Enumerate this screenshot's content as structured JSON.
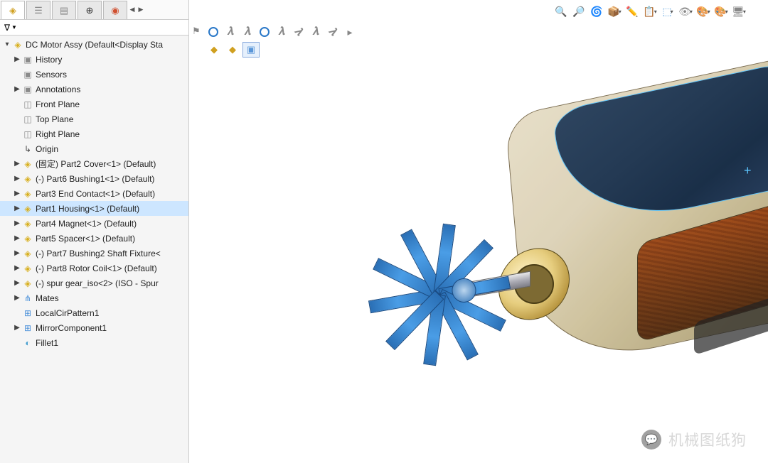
{
  "tabs": [
    "assembly",
    "config",
    "property",
    "origin",
    "appearance"
  ],
  "filter_label": "▼",
  "tree": {
    "root": {
      "icon": "asm",
      "label": "DC Motor Assy  (Default<Display Sta",
      "exp": true
    },
    "nodes": [
      {
        "indent": 1,
        "toggle": "▶",
        "icon": "grey",
        "label": "History"
      },
      {
        "indent": 1,
        "toggle": "",
        "icon": "grey",
        "label": "Sensors"
      },
      {
        "indent": 1,
        "toggle": "▶",
        "icon": "grey",
        "label": "Annotations"
      },
      {
        "indent": 1,
        "toggle": "",
        "icon": "plane",
        "label": "Front Plane"
      },
      {
        "indent": 1,
        "toggle": "",
        "icon": "plane",
        "label": "Top Plane"
      },
      {
        "indent": 1,
        "toggle": "",
        "icon": "plane",
        "label": "Right Plane"
      },
      {
        "indent": 1,
        "toggle": "",
        "icon": "origin",
        "label": "Origin"
      },
      {
        "indent": 1,
        "toggle": "▶",
        "icon": "part",
        "label": "(固定) Part2 Cover<1> (Default)"
      },
      {
        "indent": 1,
        "toggle": "▶",
        "icon": "part",
        "label": "(-) Part6 Bushing1<1> (Default)"
      },
      {
        "indent": 1,
        "toggle": "▶",
        "icon": "part",
        "label": "Part3 End Contact<1> (Default)"
      },
      {
        "indent": 1,
        "toggle": "▶",
        "icon": "part",
        "label": "Part1 Housing<1> (Default)",
        "selected": true
      },
      {
        "indent": 1,
        "toggle": "▶",
        "icon": "part",
        "label": "Part4 Magnet<1> (Default)"
      },
      {
        "indent": 1,
        "toggle": "▶",
        "icon": "part",
        "label": "Part5 Spacer<1> (Default)"
      },
      {
        "indent": 1,
        "toggle": "▶",
        "icon": "part",
        "label": "(-) Part7 Bushing2 Shaft Fixture<"
      },
      {
        "indent": 1,
        "toggle": "▶",
        "icon": "part",
        "label": "(-) Part8 Rotor Coil<1> (Default)"
      },
      {
        "indent": 1,
        "toggle": "▶",
        "icon": "part",
        "label": "(-) spur gear_iso<2> (ISO - Spur"
      },
      {
        "indent": 1,
        "toggle": "▶",
        "icon": "mate",
        "label": "Mates"
      },
      {
        "indent": 1,
        "toggle": "",
        "icon": "feat",
        "label": "LocalCirPattern1"
      },
      {
        "indent": 1,
        "toggle": "▶",
        "icon": "feat",
        "label": "MirrorComponent1"
      },
      {
        "indent": 1,
        "toggle": "",
        "icon": "fillet",
        "label": "Fillet1"
      }
    ]
  },
  "main_toolbar": [
    {
      "name": "zoom-fit-icon",
      "glyph": "🔍",
      "color": "#3a78c8"
    },
    {
      "name": "zoom-area-icon",
      "glyph": "🔎",
      "color": "#3a78c8"
    },
    {
      "name": "zoom-previous-icon",
      "glyph": "🌀",
      "color": "#e08030"
    },
    {
      "name": "section-view-icon",
      "glyph": "📦",
      "color": "#3a78c8",
      "dd": true
    },
    {
      "name": "dynamic-view-icon",
      "glyph": "✏️",
      "color": "#e08030"
    },
    {
      "name": "view-orientation-icon",
      "glyph": "📋",
      "color": "#3a78c8",
      "dd": true
    },
    {
      "name": "display-style-icon",
      "glyph": "⬚",
      "color": "#5aa0dd",
      "dd": true
    },
    {
      "name": "hide-show-icon",
      "glyph": "👁",
      "color": "#888",
      "dd": true
    },
    {
      "name": "edit-appearance-icon",
      "glyph": "🎨",
      "color": "#d0503a",
      "dd": true
    },
    {
      "name": "scene-icon",
      "glyph": "🎨",
      "color": "#d0503a",
      "dd": true
    },
    {
      "name": "display-icon",
      "glyph": "🖥",
      "color": "#888",
      "dd": true
    }
  ],
  "sub_toolbar": [
    {
      "name": "concentric-1",
      "type": "circ"
    },
    {
      "name": "axis-1",
      "type": "lam"
    },
    {
      "name": "axis-2",
      "type": "lam"
    },
    {
      "name": "concentric-2",
      "type": "circ"
    },
    {
      "name": "axis-3",
      "type": "lam"
    },
    {
      "name": "edge-1",
      "type": "lam",
      "rot": 45
    },
    {
      "name": "axis-4",
      "type": "lam"
    },
    {
      "name": "edge-2",
      "type": "lam",
      "rot": 45
    },
    {
      "name": "more",
      "type": "arrow"
    }
  ],
  "cfg_bar": [
    {
      "name": "cfg-assembly",
      "glyph": "◆",
      "color": "#d0a020"
    },
    {
      "name": "cfg-part",
      "glyph": "◆",
      "color": "#d0a020"
    },
    {
      "name": "cfg-solid",
      "glyph": "▣",
      "color": "#5a96d8",
      "active": true
    }
  ],
  "flag": "⚑",
  "watermark": {
    "icon": "💬",
    "text": "机械图纸狗"
  }
}
